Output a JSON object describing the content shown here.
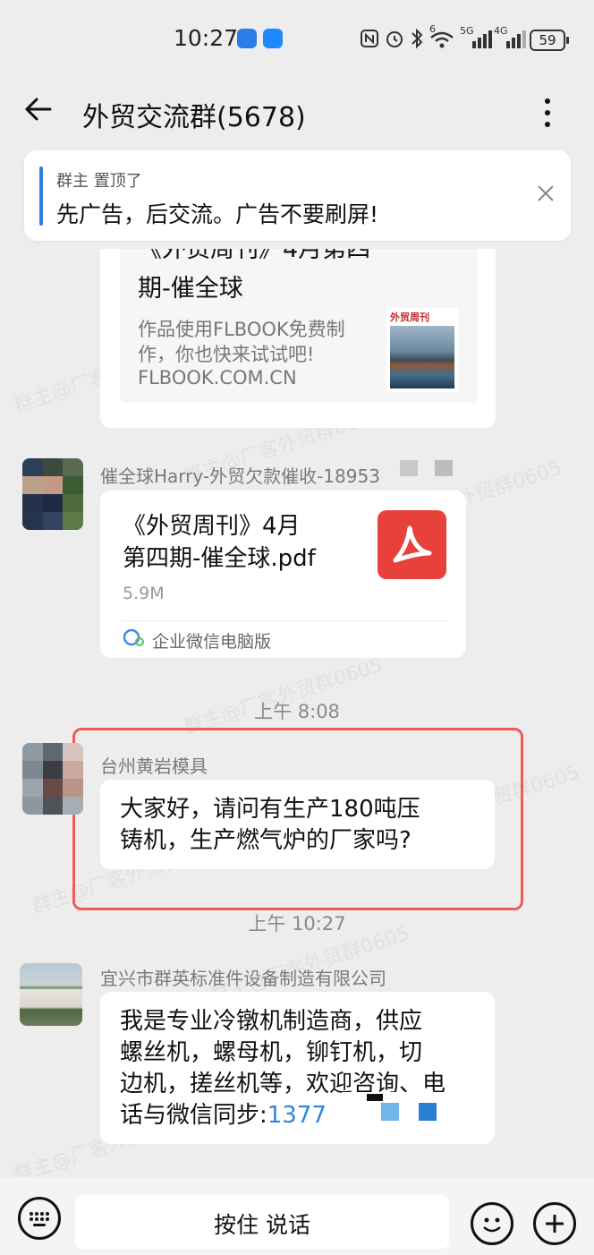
{
  "status_bar": {
    "time": "10:27",
    "network_label_5g": "5G",
    "network_label_4g": "4G",
    "wifi_label": "6",
    "battery": "59"
  },
  "header": {
    "title": "外贸交流群(5678)"
  },
  "pinned": {
    "meta": "群主 置顶了",
    "text": "先广告，后交流。广告不要刷屏!"
  },
  "watermark": "群主@厂客外贸群0605",
  "messages": [
    {
      "type": "link_card",
      "title_partial": "《外贸周刊》4月第四",
      "title_line2": "期-催全球",
      "description": "作品使用FLBOOK免费制作，你也快来试试吧!",
      "desc_line1": "作品使用FLBOOK免费制",
      "desc_line2": "作，你也快来试试吧!",
      "domain": "FLBOOK.COM.CN",
      "thumb_label": "外贸周刊"
    },
    {
      "type": "file",
      "sender": "催全球Harry-外贸欠款催收-18953",
      "file_line1": "《外贸周刊》4月",
      "file_line2": "第四期-催全球.pdf",
      "size": "5.9M",
      "source": "企业微信电脑版"
    },
    {
      "type": "time",
      "text": "上午 8:08"
    },
    {
      "type": "text",
      "sender": "台州黄岩模具",
      "line1": "大家好，请问有生产180吨压",
      "line2": "铸机，生产燃气炉的厂家吗?"
    },
    {
      "type": "time",
      "text": "上午 10:27"
    },
    {
      "type": "text",
      "sender": "宜兴市群英标准件设备制造有限公司",
      "line1": "我是专业冷镦机制造商，供应",
      "line2": "螺丝机，螺母机，铆钉机，切",
      "line3": "边机，搓丝机等，欢迎咨询、电",
      "line4_prefix": "话与微信同步:",
      "phone": "1377"
    }
  ],
  "input_bar": {
    "hold_to_talk": "按住 说话"
  },
  "colors": {
    "highlight_box": "#f05a5a",
    "link_blue": "#2f86de",
    "pdf_red": "#e8403a"
  }
}
